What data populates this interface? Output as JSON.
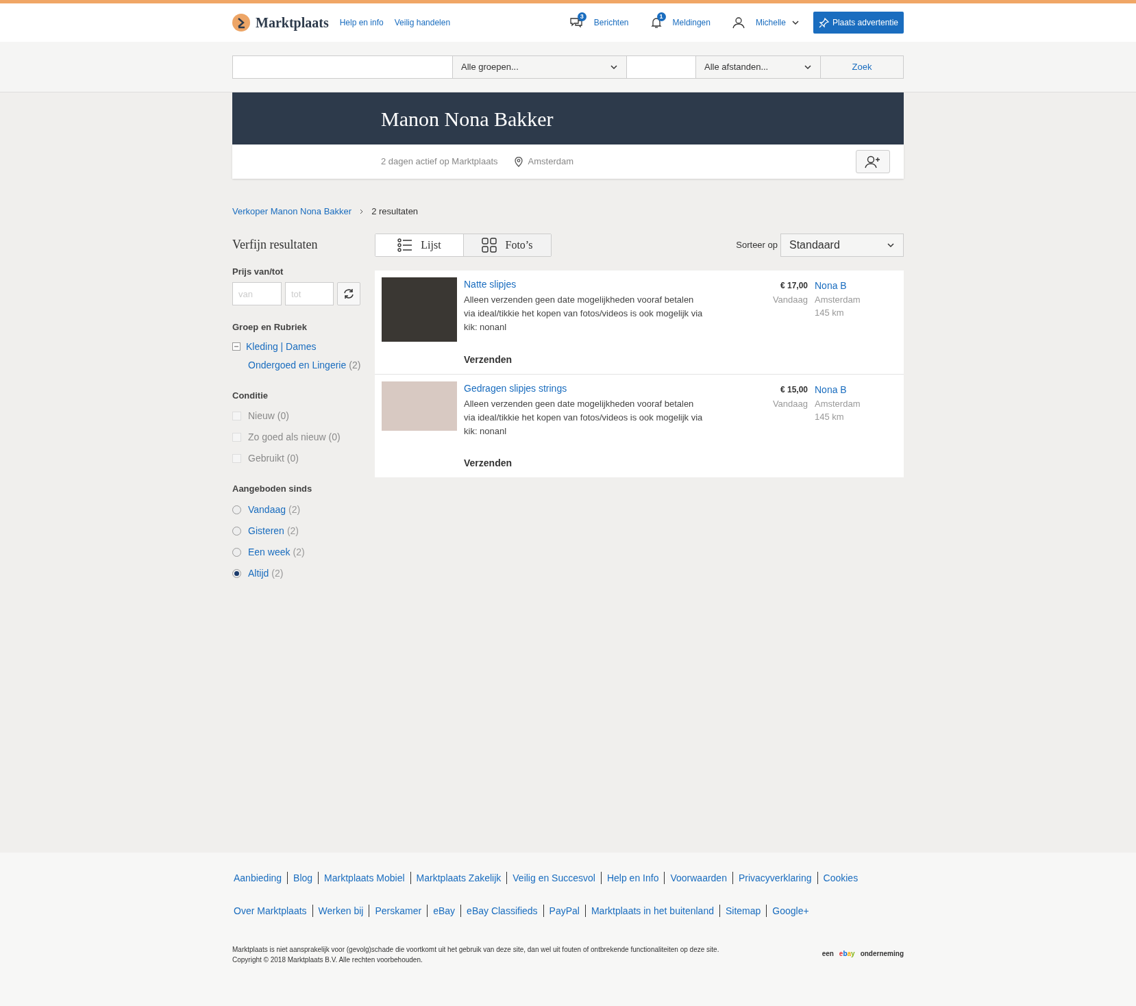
{
  "header": {
    "logo": "Marktplaats",
    "links": [
      "Help en info",
      "Veilig handelen"
    ],
    "messages": {
      "label": "Berichten",
      "badge": "3"
    },
    "notifications": {
      "label": "Meldingen",
      "badge": "1"
    },
    "user": {
      "label": "Michelle"
    },
    "cta": "Plaats advertentie"
  },
  "search": {
    "category": "Alle groepen...",
    "distance": "Alle afstanden...",
    "button": "Zoek"
  },
  "profile": {
    "name": "Manon Nona Bakker",
    "active_since": "2 dagen actief op Marktplaats",
    "location": "Amsterdam"
  },
  "breadcrumb": {
    "link": "Verkoper Manon Nona Bakker",
    "current": "2 resultaten"
  },
  "filters": {
    "title": "Verfijn resultaten",
    "price": {
      "label": "Prijs van/tot",
      "from_placeholder": "van",
      "to_placeholder": "tot"
    },
    "group": {
      "label": "Groep en Rubriek",
      "category": "Kleding | Dames",
      "subcategory": "Ondergoed en Lingerie",
      "count": "(2)"
    },
    "condition": {
      "label": "Conditie",
      "options": [
        {
          "label": "Nieuw",
          "count": "(0)",
          "checked": false,
          "disabled": true
        },
        {
          "label": "Zo goed als nieuw",
          "count": "(0)",
          "checked": false,
          "disabled": true
        },
        {
          "label": "Gebruikt",
          "count": "(0)",
          "checked": false,
          "disabled": true
        }
      ]
    },
    "since": {
      "label": "Aangeboden sinds",
      "options": [
        {
          "label": "Vandaag",
          "count": "(2)",
          "selected": false
        },
        {
          "label": "Gisteren",
          "count": "(2)",
          "selected": false
        },
        {
          "label": "Een week",
          "count": "(2)",
          "selected": false
        },
        {
          "label": "Altijd",
          "count": "(2)",
          "selected": true
        }
      ]
    }
  },
  "view_toggle": [
    {
      "label": "Lijst",
      "kind": "list",
      "selected": true
    },
    {
      "label": "Foto’s",
      "kind": "grid",
      "selected": false
    }
  ],
  "sort": {
    "label": "Sorteer op",
    "value": "Standaard"
  },
  "listings": [
    {
      "title": "Natte slipjes",
      "description": "Alleen verzenden geen date mogelijkheden vooraf betalen via ideal/tikkie het kopen van fotos/videos is ook mogelijk via kik: nonanl",
      "delivery": "Verzenden",
      "price": "€ 17,00",
      "date": "Vandaag",
      "seller": "Nona B",
      "location": "Amsterdam",
      "distance": "145 km"
    },
    {
      "title": "Gedragen slipjes strings",
      "description": "Alleen verzenden geen date mogelijkheden vooraf betalen via ideal/tikkie het kopen van fotos/videos is ook mogelijk via kik: nonanl",
      "delivery": "Verzenden",
      "price": "€ 15,00",
      "date": "Vandaag",
      "seller": "Nona B",
      "location": "Amsterdam",
      "distance": "145 km"
    }
  ],
  "footer": {
    "links_row1": [
      "Aanbieding",
      "Blog",
      "Marktplaats Mobiel",
      "Marktplaats Zakelijk",
      "Veilig en Succesvol",
      "Help en Info",
      "Voorwaarden",
      "Privacyverklaring",
      "Cookies"
    ],
    "links_row2": [
      "Over Marktplaats",
      "Werken bij",
      "Perskamer",
      "eBay",
      "eBay Classifieds",
      "PayPal",
      "Marktplaats in het buitenland",
      "Sitemap",
      "Google+"
    ],
    "disclaimer": "Marktplaats is niet aansprakelijk voor (gevolg)schade die voortkomt uit het gebruik van deze site, dan wel uit fouten of ontbrekende functionaliteiten op deze site.",
    "copyright": "Copyright © 2018 Marktplaats B.V. Alle rechten voorbehouden.",
    "company": {
      "prefix": "een",
      "logo": "ebay",
      "suffix": "onderneming"
    }
  }
}
